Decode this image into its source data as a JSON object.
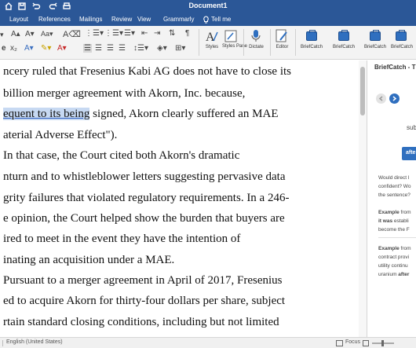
{
  "titlebar": {
    "title": "Document1"
  },
  "menu": {
    "tabs": [
      "Layout",
      "References",
      "Mailings",
      "Review",
      "View",
      "Grammarly"
    ],
    "tell_me": "Tell me"
  },
  "ribbon": {
    "font_size_glyph": "Aa",
    "styles_label": "Styles",
    "styles_pane_label": "Styles Pane",
    "dictate_label": "Dictate",
    "editor_label": "Editor",
    "briefcatch_labels": [
      "BriefCatch",
      "BriefCatch",
      "BriefCatch",
      "BriefCatch",
      "BriefC"
    ]
  },
  "document": {
    "lines": [
      "ncery ruled that Fresenius Kabi AG does not have to close its",
      "billion merger agreement with Akorn, Inc. because,",
      "signed, Akorn clearly suffered an MAE",
      "aterial Adverse Effect\").",
      "In that case, the Court cited both Akorn's dramatic",
      "nturn and to whistleblower letters suggesting pervasive data",
      "grity failures that violated regulatory requirements. In a 246-",
      "e opinion, the Court helped show the burden that buyers are",
      "ired to meet in the event they have the intention of",
      "inating an acquisition under a MAE.",
      "Pursuant to a merger agreement in April of 2017, Fresenius",
      "ed to acquire Akorn for thirty-four dollars per share, subject",
      "rtain standard closing conditions, including but not limited"
    ],
    "highlight_text": "equent to its being",
    "highlight_suffix": " signed, Akorn clearly suffered an MAE"
  },
  "pane": {
    "title": "BriefCatch - T",
    "sub": "sub",
    "after_button": "afte",
    "question_lines": [
      "Would direct l",
      "confident? Wo",
      "the sentence?"
    ],
    "example1": {
      "label": "Example",
      "rest": " from",
      "line2_bold": "it was",
      "line2_rest": " establi",
      "line3": "become the F"
    },
    "example2": {
      "label": "Example",
      "rest": " from",
      "line2": "contract provi",
      "line3": "utility continu",
      "line4_pre": "uranium ",
      "line4_bold": "after"
    }
  },
  "statusbar": {
    "language": "English (United States)",
    "focus": "Focus"
  },
  "colors": {
    "title_bar": "#2b5797",
    "accent": "#2f6fbf",
    "selection": "#c7d9f2"
  }
}
